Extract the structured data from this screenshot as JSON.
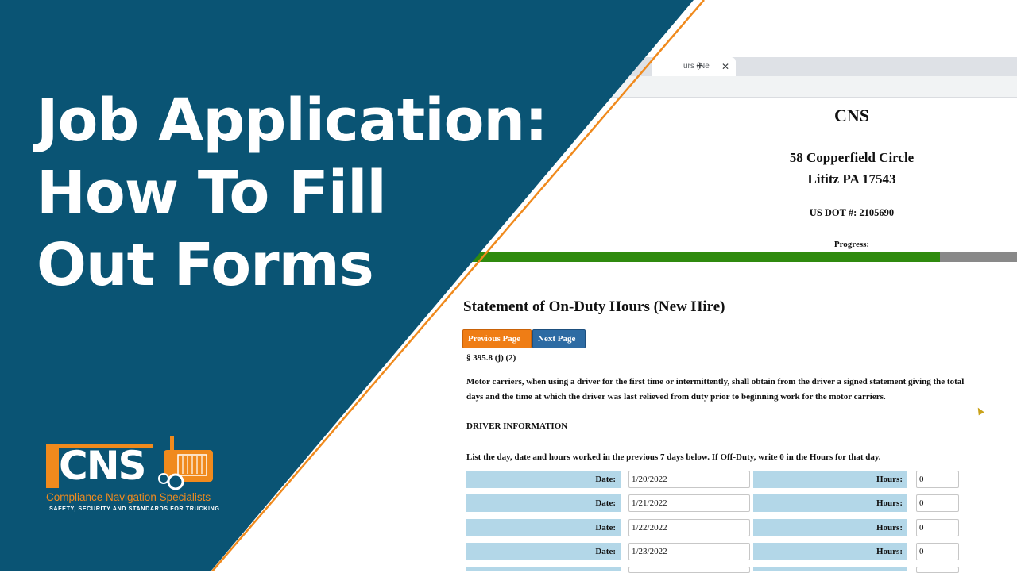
{
  "browser": {
    "tab_title": "urs (Ne",
    "tab_close": "✕",
    "new_tab": "+"
  },
  "company": {
    "name": "CNS",
    "address_line1": "58 Copperfield Circle",
    "address_line2": "Lititz PA 17543",
    "usdot": "US DOT #: 2105690"
  },
  "progress": {
    "label": "Progress:",
    "value": 0.86
  },
  "form": {
    "title": "Statement of On-Duty Hours (New Hire)",
    "prev_label": "Previous Page",
    "next_label": "Next Page",
    "citation": "§ 395.8 (j) (2)",
    "paragraph_line1": "Motor carriers, when using a driver for the first time or intermittently, shall obtain from the driver a signed statement giving the total",
    "paragraph_line2": "days and the time at which the driver was last relieved from duty prior to beginning work for the motor carriers.",
    "section_heading": "DRIVER INFORMATION",
    "instructions": "List the day, date and hours worked in the previous 7 days below. If Off-Duty, write 0 in the Hours for that day.",
    "rows": [
      {
        "date_label": "Date:",
        "date": "1/20/2022",
        "hours_label": "Hours:",
        "hours": "0"
      },
      {
        "date_label": "Date:",
        "date": "1/21/2022",
        "hours_label": "Hours:",
        "hours": "0"
      },
      {
        "date_label": "Date:",
        "date": "1/22/2022",
        "hours_label": "Hours:",
        "hours": "0"
      },
      {
        "date_label": "Date:",
        "date": "1/23/2022",
        "hours_label": "Hours:",
        "hours": "0"
      }
    ]
  },
  "overlay": {
    "headline_line1": "Job Application:",
    "headline_line2": "How To Fill",
    "headline_line3": "Out Forms",
    "panel_color": "#0a5474",
    "accent_color": "#f08a1d"
  },
  "logo": {
    "letters": "CNS",
    "name": "Compliance Navigation Specialists",
    "tagline": "SAFETY, SECURITY AND STANDARDS FOR TRUCKING"
  }
}
